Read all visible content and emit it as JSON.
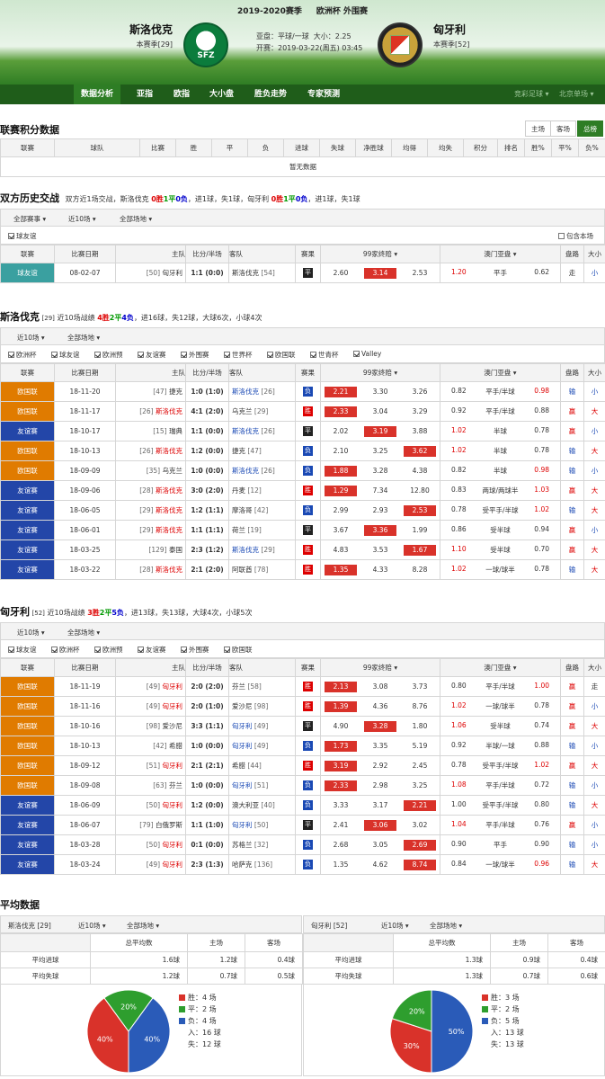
{
  "header": {
    "season": "2019-2020赛季",
    "competition": "欧洲杯 外围赛",
    "home_name": "斯洛伐克",
    "home_rank": "本赛季[29]",
    "away_name": "匈牙利",
    "away_rank": "本赛季[52]",
    "home_logo": "SFZ",
    "handicap": "亚盘：平球/一球",
    "ou": "大小：2.25",
    "kickoff": "开赛：2019-03-22(周五) 03:45"
  },
  "nav": {
    "items": [
      "数据分析",
      "亚指",
      "欧指",
      "大小盘",
      "胜负走势",
      "专家预测"
    ],
    "right1": "竞彩足球",
    "right2": "北京单场"
  },
  "league": {
    "title": "联赛积分数据",
    "tabs": [
      "主场",
      "客场",
      "总榜"
    ],
    "headers": [
      "联赛",
      "球队",
      "比赛",
      "胜",
      "平",
      "负",
      "进球",
      "失球",
      "净胜球",
      "均得",
      "均失",
      "积分",
      "排名",
      "胜%",
      "平%",
      "负%"
    ],
    "empty": "暂无数据"
  },
  "h2h": {
    "title": "双方历史交战",
    "summary": "双方近1场交战，斯洛伐克 0胜1平0负，进1球，失1球，匈牙利 0胜1平0负，进1球，失1球",
    "filters": [
      "全部赛事",
      "近10场",
      "全部场地"
    ],
    "check": "球友谊",
    "include": "包含本场",
    "headers": [
      "联赛",
      "比赛日期",
      "主队",
      "比分/半场",
      "客队",
      "赛果",
      "99家终赔",
      "澳门亚盘",
      "盘路",
      "大小"
    ],
    "rows": [
      {
        "lg": "球友谊",
        "date": "08-02-07",
        "hr": "[50]",
        "home": "匈牙利",
        "score": "1:1 (0:0)",
        "away": "斯洛伐克",
        "ar": "[54]",
        "res": "平",
        "o1": "2.60",
        "o2": "3.14",
        "o3": "2.53",
        "a1": "1.20",
        "a2": "平手",
        "a3": "0.62",
        "pl": "走",
        "dx": "小"
      }
    ]
  },
  "home_recent": {
    "title": "斯洛伐克",
    "rank": "[29]",
    "summary": "近10场战绩 4胜2平4负，进16球，失12球，大球6次，小球4次",
    "filters": [
      "近10场",
      "全部场地"
    ],
    "checks": [
      "欧洲杯",
      "球友谊",
      "欧洲预",
      "友谊赛",
      "外围赛",
      "世界杯",
      "欧国联",
      "世青杯",
      "Valley"
    ],
    "rows": [
      {
        "lg": "欧国联",
        "c": "o",
        "date": "18-11-20",
        "hr": "[47]",
        "home": "捷克",
        "score": "1:0 (1:0)",
        "away": "斯洛伐克",
        "ar": "[26]",
        "res": "负",
        "o1": "2.21",
        "o2": "3.30",
        "o3": "3.26",
        "h": 1,
        "a1": "0.82",
        "a2": "平手/半球",
        "a3": "0.98",
        "pl": "输",
        "dx": "小"
      },
      {
        "lg": "欧国联",
        "c": "o",
        "date": "18-11-17",
        "hr": "[26]",
        "home": "斯洛伐克",
        "score": "4:1 (2:0)",
        "away": "乌克兰",
        "ar": "[29]",
        "res": "胜",
        "o1": "2.33",
        "o2": "3.04",
        "o3": "3.29",
        "h": 1,
        "a1": "0.92",
        "a2": "平手/半球",
        "a3": "0.88",
        "pl": "赢",
        "dx": "大"
      },
      {
        "lg": "友谊赛",
        "c": "b",
        "date": "18-10-17",
        "hr": "[15]",
        "home": "瑞典",
        "score": "1:1 (0:0)",
        "away": "斯洛伐克",
        "ar": "[26]",
        "res": "平",
        "o1": "2.02",
        "o2": "3.19",
        "o3": "3.88",
        "h": 2,
        "a1": "1.02",
        "a2": "半球",
        "a3": "0.78",
        "pl": "赢",
        "dx": "小"
      },
      {
        "lg": "欧国联",
        "c": "o",
        "date": "18-10-13",
        "hr": "[26]",
        "home": "斯洛伐克",
        "score": "1:2 (0:0)",
        "away": "捷克",
        "ar": "[47]",
        "res": "负",
        "o1": "2.10",
        "o2": "3.25",
        "o3": "3.62",
        "h": 3,
        "a1": "1.02",
        "a2": "半球",
        "a3": "0.78",
        "pl": "输",
        "dx": "大"
      },
      {
        "lg": "欧国联",
        "c": "o",
        "date": "18-09-09",
        "hr": "[35]",
        "home": "乌克兰",
        "score": "1:0 (0:0)",
        "away": "斯洛伐克",
        "ar": "[26]",
        "res": "负",
        "o1": "1.88",
        "o2": "3.28",
        "o3": "4.38",
        "h": 1,
        "a1": "0.82",
        "a2": "半球",
        "a3": "0.98",
        "pl": "输",
        "dx": "小"
      },
      {
        "lg": "友谊赛",
        "c": "b",
        "date": "18-09-06",
        "hr": "[28]",
        "home": "斯洛伐克",
        "score": "3:0 (2:0)",
        "away": "丹麦",
        "ar": "[12]",
        "res": "胜",
        "o1": "1.29",
        "o2": "7.34",
        "o3": "12.80",
        "h": 1,
        "a1": "0.83",
        "a2": "两球/两球半",
        "a3": "1.03",
        "pl": "赢",
        "dx": "大"
      },
      {
        "lg": "友谊赛",
        "c": "b",
        "date": "18-06-05",
        "hr": "[29]",
        "home": "斯洛伐克",
        "score": "1:2 (1:1)",
        "away": "摩洛哥",
        "ar": "[42]",
        "res": "负",
        "o1": "2.99",
        "o2": "2.93",
        "o3": "2.53",
        "h": 3,
        "a1": "0.78",
        "a2": "受平手/半球",
        "a3": "1.02",
        "pl": "输",
        "dx": "大"
      },
      {
        "lg": "友谊赛",
        "c": "b",
        "date": "18-06-01",
        "hr": "[29]",
        "home": "斯洛伐克",
        "score": "1:1 (1:1)",
        "away": "荷兰",
        "ar": "[19]",
        "res": "平",
        "o1": "3.67",
        "o2": "3.36",
        "o3": "1.99",
        "h": 2,
        "a1": "0.86",
        "a2": "受半球",
        "a3": "0.94",
        "pl": "赢",
        "dx": "小"
      },
      {
        "lg": "友谊赛",
        "c": "b",
        "date": "18-03-25",
        "hr": "[129]",
        "home": "泰国",
        "score": "2:3 (1:2)",
        "away": "斯洛伐克",
        "ar": "[29]",
        "res": "胜",
        "o1": "4.83",
        "o2": "3.53",
        "o3": "1.67",
        "h": 3,
        "a1": "1.10",
        "a2": "受半球",
        "a3": "0.70",
        "pl": "赢",
        "dx": "大"
      },
      {
        "lg": "友谊赛",
        "c": "b",
        "date": "18-03-22",
        "hr": "[28]",
        "home": "斯洛伐克",
        "score": "2:1 (2:0)",
        "away": "阿联酋",
        "ar": "[78]",
        "res": "胜",
        "o1": "1.35",
        "o2": "4.33",
        "o3": "8.28",
        "h": 1,
        "a1": "1.02",
        "a2": "一球/球半",
        "a3": "0.78",
        "pl": "输",
        "dx": "大"
      }
    ]
  },
  "away_recent": {
    "title": "匈牙利",
    "rank": "[52]",
    "summary": "近10场战绩 3胜2平5负，进13球，失13球，大球4次，小球5次",
    "filters": [
      "近10场",
      "全部场地"
    ],
    "checks": [
      "球友谊",
      "欧洲杯",
      "欧洲预",
      "友谊赛",
      "外围赛",
      "欧国联"
    ],
    "rows": [
      {
        "lg": "欧国联",
        "c": "o",
        "date": "18-11-19",
        "hr": "[49]",
        "home": "匈牙利",
        "score": "2:0 (2:0)",
        "away": "芬兰",
        "ar": "[58]",
        "res": "胜",
        "o1": "2.13",
        "o2": "3.08",
        "o3": "3.73",
        "h": 1,
        "a1": "0.80",
        "a2": "平手/半球",
        "a3": "1.00",
        "pl": "赢",
        "dx": "走"
      },
      {
        "lg": "欧国联",
        "c": "o",
        "date": "18-11-16",
        "hr": "[49]",
        "home": "匈牙利",
        "score": "2:0 (1:0)",
        "away": "爱沙尼",
        "ar": "[98]",
        "res": "胜",
        "o1": "1.39",
        "o2": "4.36",
        "o3": "8.76",
        "h": 1,
        "a1": "1.02",
        "a2": "一球/球半",
        "a3": "0.78",
        "pl": "赢",
        "dx": "小"
      },
      {
        "lg": "欧国联",
        "c": "o",
        "date": "18-10-16",
        "hr": "[98]",
        "home": "爱沙尼",
        "score": "3:3 (1:1)",
        "away": "匈牙利",
        "ar": "[49]",
        "res": "平",
        "o1": "4.90",
        "o2": "3.28",
        "o3": "1.80",
        "h": 2,
        "a1": "1.06",
        "a2": "受半球",
        "a3": "0.74",
        "pl": "赢",
        "dx": "大"
      },
      {
        "lg": "欧国联",
        "c": "o",
        "date": "18-10-13",
        "hr": "[42]",
        "home": "希腊",
        "score": "1:0 (0:0)",
        "away": "匈牙利",
        "ar": "[49]",
        "res": "负",
        "o1": "1.73",
        "o2": "3.35",
        "o3": "5.19",
        "h": 1,
        "a1": "0.92",
        "a2": "半球/一球",
        "a3": "0.88",
        "pl": "输",
        "dx": "小"
      },
      {
        "lg": "欧国联",
        "c": "o",
        "date": "18-09-12",
        "hr": "[51]",
        "home": "匈牙利",
        "score": "2:1 (2:1)",
        "away": "希腊",
        "ar": "[44]",
        "res": "胜",
        "o1": "3.19",
        "o2": "2.92",
        "o3": "2.45",
        "h": 1,
        "a1": "0.78",
        "a2": "受平手/半球",
        "a3": "1.02",
        "pl": "赢",
        "dx": "大"
      },
      {
        "lg": "欧国联",
        "c": "o",
        "date": "18-09-08",
        "hr": "[63]",
        "home": "芬兰",
        "score": "1:0 (0:0)",
        "away": "匈牙利",
        "ar": "[51]",
        "res": "负",
        "o1": "2.33",
        "o2": "2.98",
        "o3": "3.25",
        "h": 1,
        "a1": "1.08",
        "a2": "平手/半球",
        "a3": "0.72",
        "pl": "输",
        "dx": "小"
      },
      {
        "lg": "友谊赛",
        "c": "b",
        "date": "18-06-09",
        "hr": "[50]",
        "home": "匈牙利",
        "score": "1:2 (0:0)",
        "away": "澳大利亚",
        "ar": "[40]",
        "res": "负",
        "o1": "3.33",
        "o2": "3.17",
        "o3": "2.21",
        "h": 3,
        "a1": "1.00",
        "a2": "受平手/半球",
        "a3": "0.80",
        "pl": "输",
        "dx": "大"
      },
      {
        "lg": "友谊赛",
        "c": "b",
        "date": "18-06-07",
        "hr": "[79]",
        "home": "白俄罗斯",
        "score": "1:1 (1:0)",
        "away": "匈牙利",
        "ar": "[50]",
        "res": "平",
        "o1": "2.41",
        "o2": "3.06",
        "o3": "3.02",
        "h": 2,
        "a1": "1.04",
        "a2": "平手/半球",
        "a3": "0.76",
        "pl": "赢",
        "dx": "小"
      },
      {
        "lg": "友谊赛",
        "c": "b",
        "date": "18-03-28",
        "hr": "[50]",
        "home": "匈牙利",
        "score": "0:1 (0:0)",
        "away": "苏格兰",
        "ar": "[32]",
        "res": "负",
        "o1": "2.68",
        "o2": "3.05",
        "o3": "2.69",
        "h": 3,
        "a1": "0.90",
        "a2": "平手",
        "a3": "0.90",
        "pl": "输",
        "dx": "小"
      },
      {
        "lg": "友谊赛",
        "c": "b",
        "date": "18-03-24",
        "hr": "[49]",
        "home": "匈牙利",
        "score": "2:3 (1:3)",
        "away": "哈萨克",
        "ar": "[136]",
        "res": "负",
        "o1": "1.35",
        "o2": "4.62",
        "o3": "8.74",
        "h": 3,
        "a1": "0.84",
        "a2": "一球/球半",
        "a3": "0.96",
        "pl": "输",
        "dx": "大"
      }
    ]
  },
  "avg": {
    "title": "平均数据",
    "headers": [
      "总平均数",
      "主场",
      "客场"
    ],
    "left": {
      "team": "斯洛伐克 [29]",
      "f1": "近10场",
      "f2": "全部场地",
      "rows": [
        [
          "平均进球",
          "1.6球",
          "1.2球",
          "0.4球"
        ],
        [
          "平均失球",
          "1.2球",
          "0.7球",
          "0.5球"
        ]
      ],
      "legend": [
        "胜：4 场",
        "平：2 场",
        "负：4 场",
        "入：16 球",
        "失：12 球"
      ]
    },
    "right": {
      "team": "匈牙利 [52]",
      "f1": "近10场",
      "f2": "全部场地",
      "rows": [
        [
          "平均进球",
          "1.3球",
          "0.9球",
          "0.4球"
        ],
        [
          "平均失球",
          "1.3球",
          "0.7球",
          "0.6球"
        ]
      ],
      "legend": [
        "胜：3 场",
        "平：2 场",
        "负：5 场",
        "入：13 球",
        "失：13 球"
      ]
    }
  },
  "chart_data": [
    {
      "type": "pie",
      "labels": [
        "胜",
        "平",
        "负"
      ],
      "values": [
        40,
        20,
        40
      ],
      "colors": [
        "#d9322a",
        "#2e9e2e",
        "#2a5bb8"
      ]
    },
    {
      "type": "pie",
      "labels": [
        "胜",
        "平",
        "负"
      ],
      "values": [
        30,
        20,
        50
      ],
      "colors": [
        "#d9322a",
        "#2e9e2e",
        "#2a5bb8"
      ]
    }
  ]
}
